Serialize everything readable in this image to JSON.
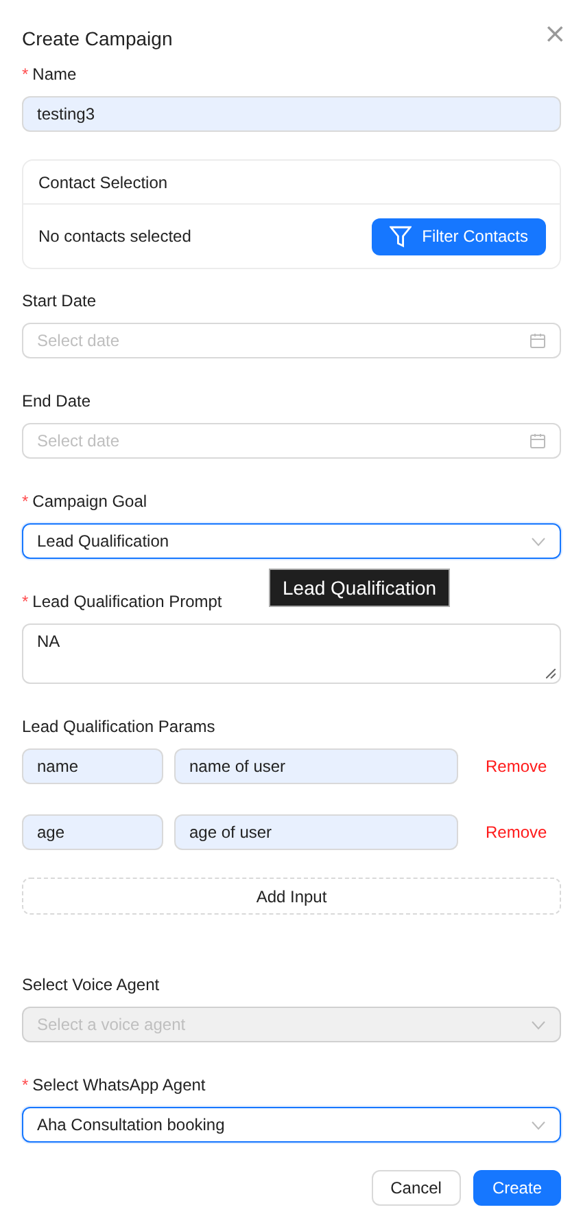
{
  "dialog": {
    "title": "Create Campaign",
    "close": "×"
  },
  "fields": [
    {
      "kind": "text",
      "label": "Name",
      "required_mark": "*",
      "value": "testing3"
    },
    {
      "kind": "contacts",
      "header": "Contact Selection",
      "status": "No contacts selected",
      "button": "Filter Contacts"
    },
    {
      "kind": "date",
      "label": "Start Date",
      "placeholder": "Select date"
    },
    {
      "kind": "date",
      "label": "End Date",
      "placeholder": "Select date"
    },
    {
      "kind": "select",
      "label": "Campaign Goal",
      "required_mark": "*",
      "value": "Lead Qualification",
      "focused": true,
      "disabled": false,
      "tooltip": "Lead Qualification"
    },
    {
      "kind": "textarea",
      "label": "Lead Qualification Prompt",
      "required_mark": "*",
      "value": "NA"
    },
    {
      "kind": "params",
      "label": "Lead Qualification Params",
      "rows": [
        {
          "key": "name",
          "description": "name of user",
          "remove": "Remove"
        },
        {
          "key": "age",
          "description": "age of user",
          "remove": "Remove"
        }
      ],
      "add": "Add Input"
    },
    {
      "kind": "select",
      "label": "Select Voice Agent",
      "placeholder": "Select a voice agent",
      "focused": false,
      "disabled": true
    },
    {
      "kind": "select",
      "label": "Select WhatsApp Agent",
      "required_mark": "*",
      "value": "Aha Consultation booking",
      "focused": true,
      "disabled": false
    }
  ],
  "buttons": [
    {
      "label": "Cancel",
      "primary": false
    },
    {
      "label": "Create",
      "primary": true
    }
  ]
}
